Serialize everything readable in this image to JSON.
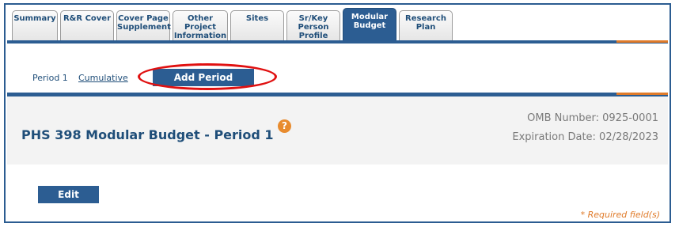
{
  "tabs": [
    {
      "label": "Summary",
      "active": false,
      "width": 58
    },
    {
      "label": "R&R Cover",
      "active": false,
      "width": 68
    },
    {
      "label": "Cover Page\nSupplement",
      "active": false,
      "width": 68
    },
    {
      "label": "Other\nProject\nInformation",
      "active": false,
      "width": 70
    },
    {
      "label": "Sites",
      "active": false,
      "width": 68
    },
    {
      "label": "Sr/Key\nPerson\nProfile",
      "active": false,
      "width": 68
    },
    {
      "label": "Modular\nBudget",
      "active": true,
      "width": 68
    },
    {
      "label": "Research\nPlan",
      "active": false,
      "width": 68
    }
  ],
  "subnav": {
    "period1_label": "Period 1",
    "cumulative_label": "Cumulative",
    "add_period_label": "Add Period"
  },
  "header": {
    "title": "PHS 398 Modular Budget - Period 1",
    "help_icon_glyph": "?",
    "omb_number": "OMB Number: 0925-0001",
    "expiration_date": "Expiration Date: 02/28/2023"
  },
  "content": {
    "edit_label": "Edit",
    "required_note": "* Required field(s)"
  },
  "colors": {
    "brand_blue": "#2c5d92",
    "accent_orange": "#e07b2a",
    "highlight_red": "#e01010"
  }
}
